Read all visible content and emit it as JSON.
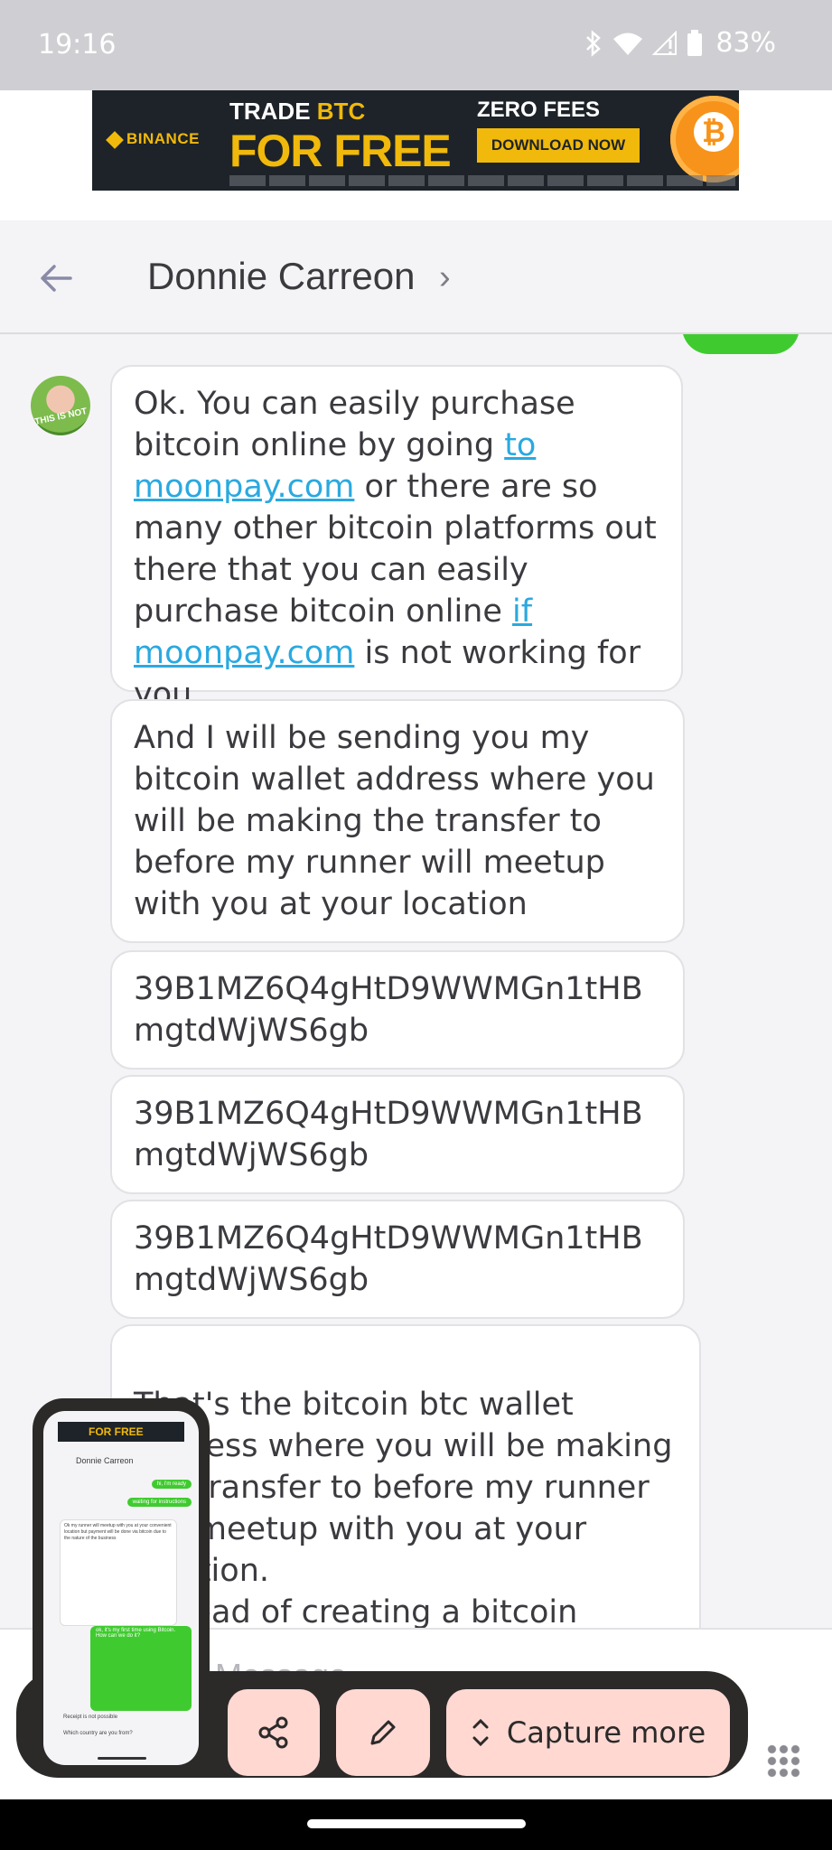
{
  "status_bar": {
    "time": "19:16",
    "battery": "83%"
  },
  "ad": {
    "brand": "BINANCE",
    "trade_prefix": "TRADE ",
    "trade_accent": "BTC",
    "headline": "FOR FREE",
    "zero_fees": "ZERO FEES",
    "cta": "DOWNLOAD NOW"
  },
  "header": {
    "title": "Donnie Carreon"
  },
  "messages": {
    "m1_a": "Ok. You can easily purchase bitcoin online by going ",
    "m1_link1": "to moonpay.com",
    "m1_b": " or there are so many other bitcoin platforms out there that you can easily purchase bitcoin online ",
    "m1_link2": "if moonpay.com",
    "m1_c": " is not working for you",
    "m2": "And I will be sending you my bitcoin wallet address where you will be making the transfer to before my runner will meetup with you at your location",
    "m3": "39B1MZ6Q4gHtD9WWMGn1tHBmgtdWjWS6gb",
    "m4": "39B1MZ6Q4gHtD9WWMGn1tHBmgtdWjWS6gb",
    "m5": "39B1MZ6Q4gHtD9WWMGn1tHBmgtdWjWS6gb",
    "m6": "That's the bitcoin btc wallet address where you will be making the transfer to before my runner will meetup with you at your location.\nInstead of creating a bitcoin account, just transfer the funds directly to the above bitcoin btc"
  },
  "compose": {
    "placeholder": "Message"
  },
  "screenshot_toolbar": {
    "capture_more": "Capture more"
  },
  "thumbnail": {
    "ad_text": "FOR FREE",
    "title": "Donnie Carreon",
    "green1": "hi, i'm ready",
    "green2": "waiting for instructions",
    "white1": "Ok my runner will meetup with you at your convenient location but payment will be done via bitcoin due to the nature of the business",
    "green3": "ok, it's my first time using Bitcoin. How can we do it?",
    "text1": "Receipt is not possible",
    "text2": "Which country are you from?"
  }
}
